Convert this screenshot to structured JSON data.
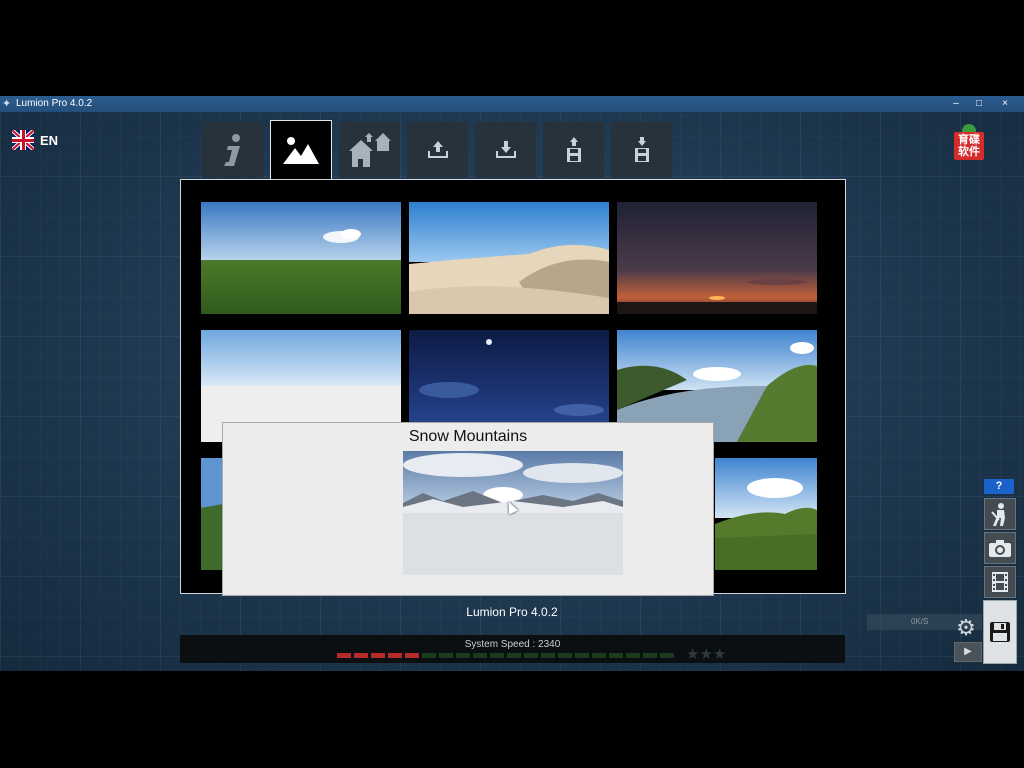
{
  "window": {
    "title": "Lumion Pro 4.0.2",
    "controls": {
      "minimize": "–",
      "maximize": "□",
      "close": "×"
    }
  },
  "language": {
    "code": "EN",
    "flag": "uk-flag"
  },
  "logo": {
    "line1": "育碟",
    "line2": "软件"
  },
  "tabs": [
    {
      "name": "info",
      "icon": "info-icon",
      "active": false
    },
    {
      "name": "landscape",
      "icon": "mountain-icon",
      "active": true
    },
    {
      "name": "example-scenes",
      "icon": "houses-icon",
      "active": false
    },
    {
      "name": "import",
      "icon": "upload-icon",
      "active": false
    },
    {
      "name": "export",
      "icon": "download-icon",
      "active": false
    },
    {
      "name": "load-scene",
      "icon": "load-disk-icon",
      "active": false
    },
    {
      "name": "save-scene",
      "icon": "save-disk-icon",
      "active": false
    }
  ],
  "landscapes": [
    {
      "id": "grassland",
      "kind": "grass"
    },
    {
      "id": "desert",
      "kind": "desert"
    },
    {
      "id": "sunset",
      "kind": "sunset"
    },
    {
      "id": "white",
      "kind": "white"
    },
    {
      "id": "night",
      "kind": "night"
    },
    {
      "id": "river",
      "kind": "river"
    },
    {
      "id": "snow-left",
      "kind": "partial"
    },
    {
      "id": "hills-right",
      "kind": "hills"
    }
  ],
  "popup": {
    "title": "Snow Mountains"
  },
  "version_label": "Lumion Pro 4.0.2",
  "system_speed": {
    "label": "System Speed : 2340",
    "leds_total": 20,
    "leds_on": 5,
    "stars": "★★★"
  },
  "sidebar": {
    "help": "?"
  },
  "hud": {
    "text": "0K/S"
  },
  "colors": {
    "background": "#1e3a52",
    "titlebar": "#2c5c8f",
    "help": "#1a62c9",
    "led_on": "#b82a2a"
  }
}
